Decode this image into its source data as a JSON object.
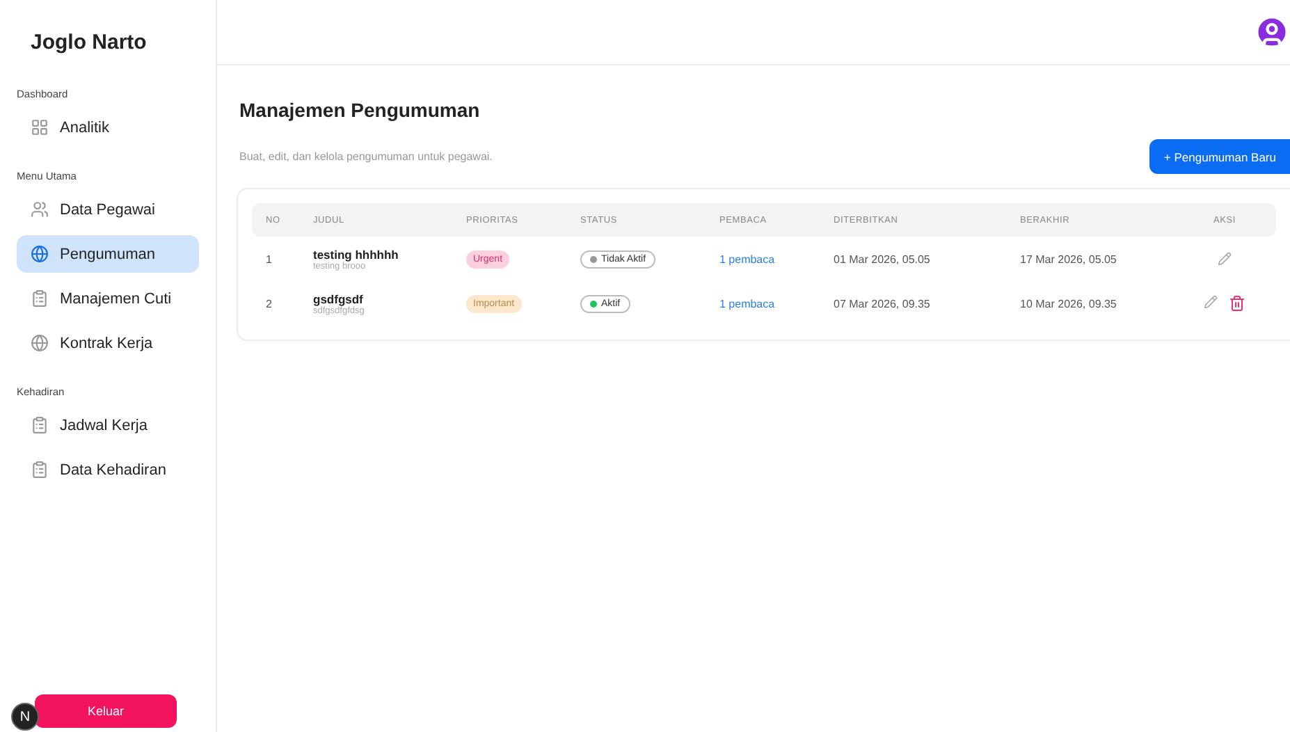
{
  "sidebar": {
    "brand": "Joglo Narto",
    "sections": [
      {
        "title": "Dashboard",
        "items": [
          {
            "label": "Analitik",
            "kind": "grid",
            "selected": false
          }
        ]
      },
      {
        "title": "Menu Utama",
        "items": [
          {
            "label": "Data Pegawai",
            "kind": "people",
            "selected": false
          },
          {
            "label": "Pengumuman",
            "kind": "globe",
            "selected": true
          },
          {
            "label": "Manajemen Cuti",
            "kind": "clipboard",
            "selected": false
          },
          {
            "label": "Kontrak Kerja",
            "kind": "globe",
            "selected": false
          }
        ]
      },
      {
        "title": "Kehadiran",
        "items": [
          {
            "label": "Jadwal Kerja",
            "kind": "clipboard",
            "selected": false
          },
          {
            "label": "Data Kehadiran",
            "kind": "clipboard",
            "selected": false
          }
        ]
      }
    ],
    "logout": "Keluar",
    "dev_badge": "N"
  },
  "page": {
    "title": "Manajemen Pengumuman",
    "subtitle": "Buat, edit, dan kelola pengumuman untuk pegawai.",
    "new_button": "+ Pengumuman Baru"
  },
  "table": {
    "columns": [
      "NO",
      "JUDUL",
      "PRIORITAS",
      "STATUS",
      "PEMBACA",
      "DITERBITKAN",
      "BERAKHIR",
      "AKSI"
    ],
    "rows": [
      {
        "no": "1",
        "title": "testing hhhhhh",
        "subtitle": "testing brooo",
        "priority": {
          "label": "Urgent",
          "kind": "urgent"
        },
        "status": {
          "label": "Tidak Aktif",
          "active": false
        },
        "readers": "1 pembaca",
        "published": "01 Mar 2026, 05.05",
        "ends": "17 Mar 2026, 05.05",
        "deletable": false
      },
      {
        "no": "2",
        "title": "gsdfgsdf",
        "subtitle": "sdfgsdfgfdsg",
        "priority": {
          "label": "Important",
          "kind": "important"
        },
        "status": {
          "label": "Aktif",
          "active": true
        },
        "readers": "1 pembaca",
        "published": "07 Mar 2026, 09.35",
        "ends": "10 Mar 2026, 09.35",
        "deletable": true
      }
    ]
  }
}
